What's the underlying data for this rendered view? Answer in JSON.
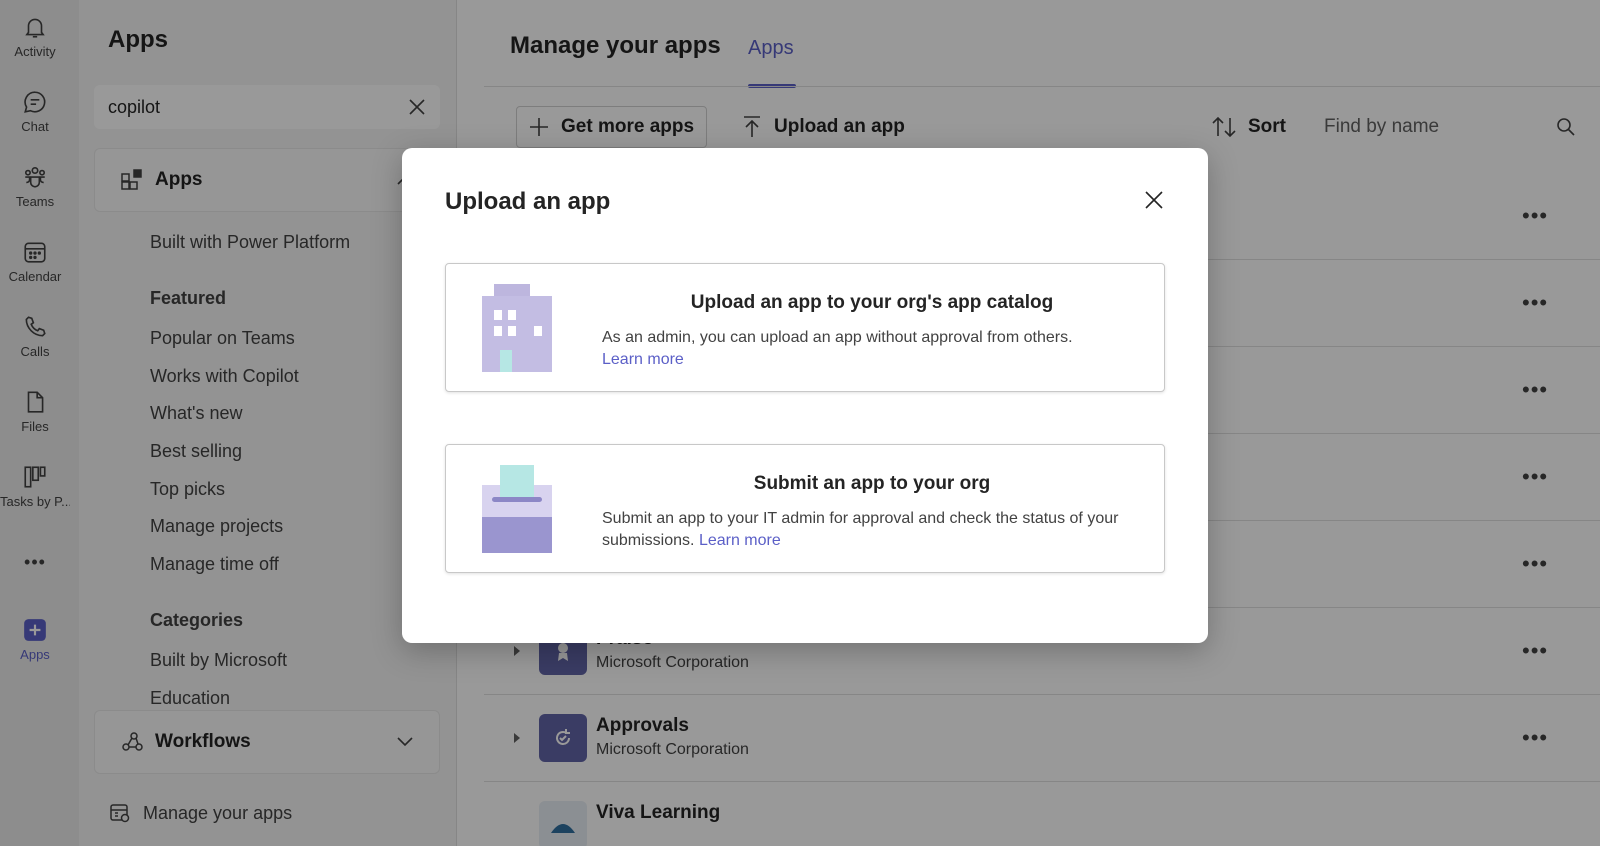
{
  "rail": {
    "items": [
      {
        "label": "Activity",
        "icon": "bell-icon"
      },
      {
        "label": "Chat",
        "icon": "chat-icon"
      },
      {
        "label": "Teams",
        "icon": "teams-icon"
      },
      {
        "label": "Calendar",
        "icon": "calendar-icon"
      },
      {
        "label": "Calls",
        "icon": "phone-icon"
      },
      {
        "label": "Files",
        "icon": "file-icon"
      },
      {
        "label": "Tasks by P...",
        "icon": "tasks-icon"
      },
      {
        "label": "Apps",
        "icon": "apps-plus-icon"
      }
    ],
    "more": "•••",
    "accent": "#5b5fc7"
  },
  "panel": {
    "title": "Apps",
    "search_value": "copilot",
    "apps_section": "Apps",
    "built_with": "Built with Power Platform",
    "featured_heading": "Featured",
    "featured": [
      "Popular on Teams",
      "Works with Copilot",
      "What's new",
      "Best selling",
      "Top picks",
      "Manage projects",
      "Manage time off"
    ],
    "categories_heading": "Categories",
    "categories": [
      "Built by Microsoft",
      "Education"
    ],
    "workflows": "Workflows",
    "manage": "Manage your apps"
  },
  "main": {
    "title": "Manage your apps",
    "tab": "Apps",
    "get_more": "Get more apps",
    "upload": "Upload an app",
    "sort": "Sort",
    "find_placeholder": "Find by name",
    "more": "•••",
    "rows": [
      {
        "name": "Praise",
        "publisher": "Microsoft Corporation"
      },
      {
        "name": "Approvals",
        "publisher": "Microsoft Corporation"
      },
      {
        "name": "Viva Learning",
        "publisher": ""
      }
    ]
  },
  "dialog": {
    "title": "Upload an app",
    "options": [
      {
        "title": "Upload an app to your org's app catalog",
        "desc": "As an admin, you can upload an app without approval from others.",
        "link": "Learn more"
      },
      {
        "title": "Submit an app to your org",
        "desc": "Submit an app to your IT admin for approval and check the status of your submissions.",
        "link": "Learn more"
      }
    ]
  }
}
